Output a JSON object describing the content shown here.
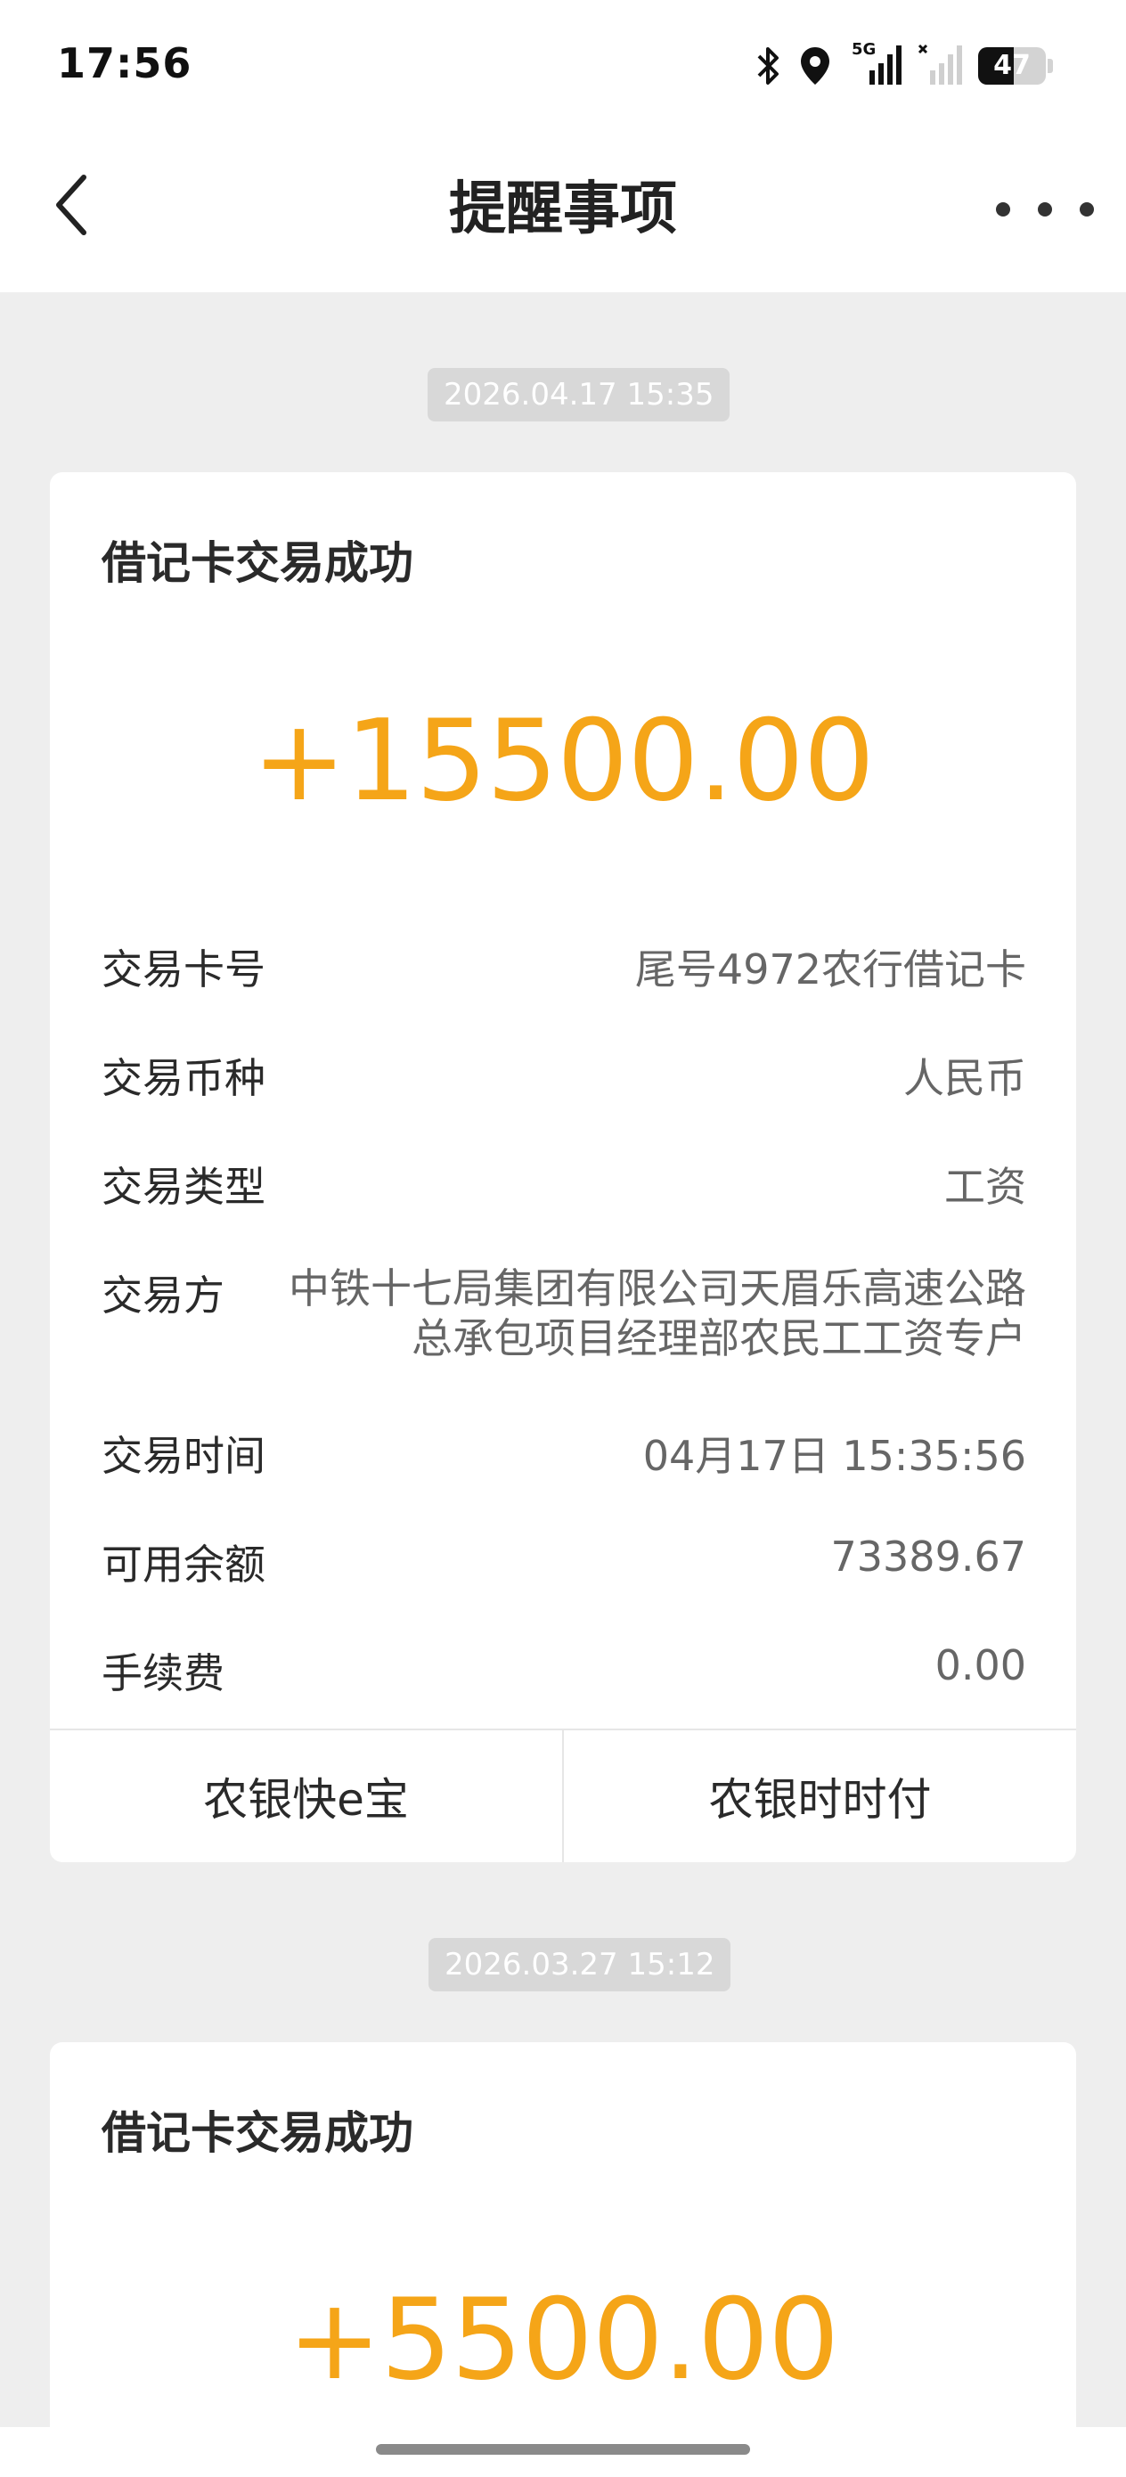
{
  "status_bar": {
    "time": "17:56",
    "network_label": "5G",
    "battery_level": "47",
    "icons": [
      "bluetooth-icon",
      "location-icon",
      "signal-5g-icon",
      "signal-no-service-icon",
      "battery-icon"
    ]
  },
  "nav": {
    "title": "提醒事项",
    "back_icon": "chevron-left-icon",
    "more_icon": "more-dots-icon"
  },
  "messages": [
    {
      "date": "2026.04.17 15:35",
      "title": "借记卡交易成功",
      "amount": "+15500.00",
      "rows": [
        {
          "label": "交易卡号",
          "value": "尾号4972农行借记卡"
        },
        {
          "label": "交易币种",
          "value": "人民币"
        },
        {
          "label": "交易类型",
          "value": "工资"
        },
        {
          "label": "交易方",
          "value": "中铁十七局集团有限公司天眉乐高速公路总承包项目经理部农民工工资专户"
        },
        {
          "label": "交易时间",
          "value": "04月17日 15:35:56"
        },
        {
          "label": "可用余额",
          "value": "73389.67"
        },
        {
          "label": "手续费",
          "value": "0.00"
        }
      ],
      "actions": [
        "农银快e宝",
        "农银时时付"
      ]
    },
    {
      "date": "2026.03.27 15:12",
      "title": "借记卡交易成功",
      "amount": "+5500.00"
    }
  ],
  "colors": {
    "amount": "#f5a518",
    "background": "#eeeeee",
    "card": "#ffffff",
    "chip": "#d8d8d8"
  }
}
